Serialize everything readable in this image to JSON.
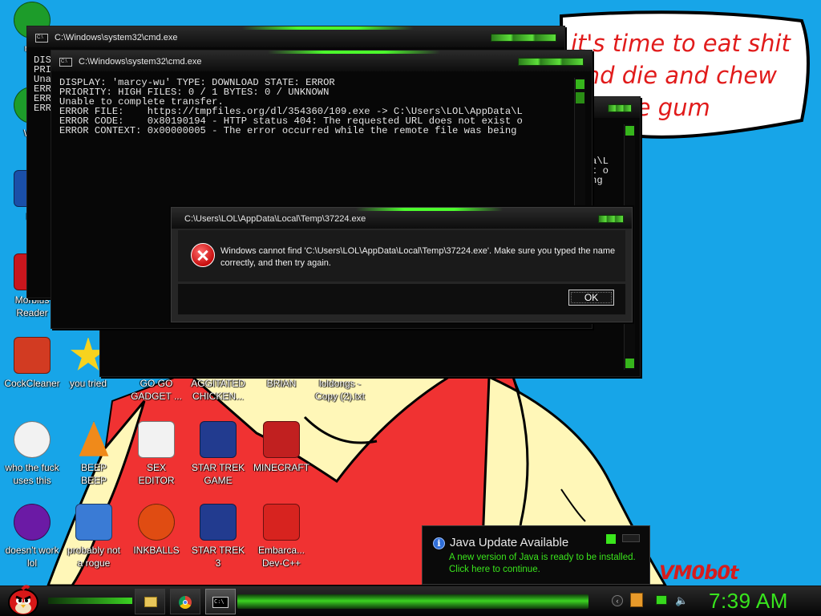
{
  "bubble": {
    "text": "it's time to eat shit\nand die and chew\nbubble gum"
  },
  "signature": "VM0b0t",
  "desktop_icons": [
    {
      "label": "mis",
      "icon": "green-orb-icon"
    },
    {
      "label": "Win\nV",
      "icon": "green-orb-icon"
    },
    {
      "label": "Po",
      "icon": "powerpoint-icon"
    },
    {
      "label": "Morbius\nReader",
      "icon": "red-book-icon"
    },
    {
      "label": "CockCleaner",
      "icon": "ccleaner-icon"
    },
    {
      "label": "you tried",
      "icon": "star-icon"
    },
    {
      "label": "GO GO\nGADGET ...",
      "icon": "shortcut-icon"
    },
    {
      "label": "AGGITATED\nCHICKEN...",
      "icon": "shortcut-icon"
    },
    {
      "label": "BRIAN",
      "icon": "shortcut-icon"
    },
    {
      "label": "loldongs -\nCopy (2).txt",
      "icon": "text-file-icon"
    },
    {
      "label": "who the fuck\nuses this",
      "icon": "avast-icon"
    },
    {
      "label": "BEEP\nBEEP",
      "icon": "vlc-cone-icon"
    },
    {
      "label": "SEX\nEDITOR",
      "icon": "hxd-icon"
    },
    {
      "label": "STAR TREK\nGAME",
      "icon": "star-wars-game-icon"
    },
    {
      "label": "MINECRAFT",
      "icon": "angry-bird-icon"
    },
    {
      "label": "doesn't work\nlol",
      "icon": "yahoo-messenger-icon"
    },
    {
      "label": "probably not\na rogue",
      "icon": "gear-program-icon"
    },
    {
      "label": "INKBALLS",
      "icon": "inkball-icon"
    },
    {
      "label": "STAR TREK\n3",
      "icon": "star-wars-game-icon"
    },
    {
      "label": "Embarca...\nDev-C++",
      "icon": "devcpp-icon"
    }
  ],
  "cmd_back": {
    "title": "C:\\Windows\\system32\\cmd.exe",
    "lines": "DIS\nPRI\nUna\nERR\nERR\nERR"
  },
  "cmd_front": {
    "title": "C:\\Windows\\system32\\cmd.exe",
    "lines": "DISPLAY: 'marcy-wu' TYPE: DOWNLOAD STATE: ERROR\nPRIORITY: HIGH FILES: 0 / 1 BYTES: 0 / UNKNOWN\nUnable to complete transfer.\nERROR FILE:    https://tmpfiles.org/dl/354360/109.exe -> C:\\Users\\LOL\\AppData\\L\nERROR CODE:    0x80190194 - HTTP status 404: The requested URL does not exist o\nERROR CONTEXT: 0x00000005 - The error occurred while the remote file was being"
  },
  "cmd_right": {
    "lines": "a\\L\nt o\nng"
  },
  "error_dialog": {
    "title": "C:\\Users\\LOL\\AppData\\Local\\Temp\\37224.exe",
    "message": "Windows cannot find 'C:\\Users\\LOL\\AppData\\Local\\Temp\\37224.exe'. Make sure you typed the name correctly, and then try again.",
    "ok_label": "OK"
  },
  "java_popup": {
    "title": "Java Update Available",
    "message": "A new version of Java is ready to be installed.\nClick here to continue."
  },
  "taskbar": {
    "clock": "7:39 AM",
    "items": [
      "file-explorer-icon",
      "chrome-icon",
      "cmd-icon"
    ]
  },
  "colors": {
    "accent": "#3bd322",
    "error": "#c70d0d",
    "desktop_blue": "#1aa7e6"
  }
}
